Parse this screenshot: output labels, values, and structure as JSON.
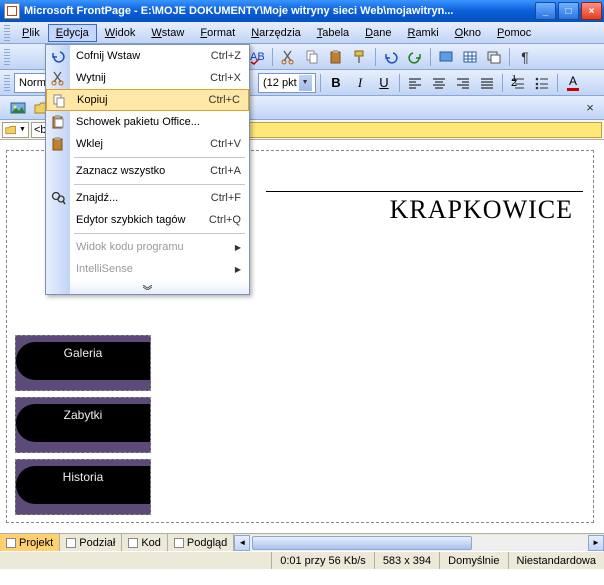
{
  "title": "Microsoft FrontPage - E:\\MOJE DOKUMENTY\\Moje witryny sieci Web\\mojawitryn...",
  "menu": {
    "items": [
      "Plik",
      "Edycja",
      "Widok",
      "Wstaw",
      "Format",
      "Narzędzia",
      "Tabela",
      "Dane",
      "Ramki",
      "Okno",
      "Pomoc"
    ],
    "open_index": 1
  },
  "dropdown": {
    "items": [
      {
        "icon": "undo-icon",
        "label": "Cofnij Wstaw",
        "shortcut": "Ctrl+Z"
      },
      {
        "icon": "cut-icon",
        "label": "Wytnij",
        "shortcut": "Ctrl+X"
      },
      {
        "icon": "copy-icon",
        "label": "Kopiuj",
        "shortcut": "Ctrl+C",
        "selected": true
      },
      {
        "icon": "clipboard-icon",
        "label": "Schowek pakietu Office...",
        "shortcut": ""
      },
      {
        "icon": "paste-icon",
        "label": "Wklej",
        "shortcut": "Ctrl+V"
      },
      {
        "sep": true
      },
      {
        "icon": "",
        "label": "Zaznacz wszystko",
        "shortcut": "Ctrl+A"
      },
      {
        "sep": true
      },
      {
        "icon": "find-icon",
        "label": "Znajdź...",
        "shortcut": "Ctrl+F"
      },
      {
        "icon": "",
        "label": "Edytor szybkich tagów",
        "shortcut": "Ctrl+Q"
      },
      {
        "sep": true
      },
      {
        "icon": "",
        "label": "Widok kodu programu",
        "submenu": true,
        "disabled": true
      },
      {
        "icon": "",
        "label": "IntelliSense",
        "submenu": true,
        "disabled": true
      }
    ]
  },
  "format_toolbar": {
    "style_combo": "Norma",
    "size_combo": "(12 pkt"
  },
  "tag_selector": "<bod",
  "document": {
    "heading": "KRAPKOWICE",
    "nav": [
      "Galeria",
      "Zabytki",
      "Historia"
    ]
  },
  "view_tabs": [
    "Projekt",
    "Podział",
    "Kod",
    "Podgląd"
  ],
  "status": {
    "speed": "0:01 przy 56 Kb/s",
    "dims": "583 x 394",
    "mode": "Domyślnie",
    "encoding": "Niestandardowa"
  }
}
